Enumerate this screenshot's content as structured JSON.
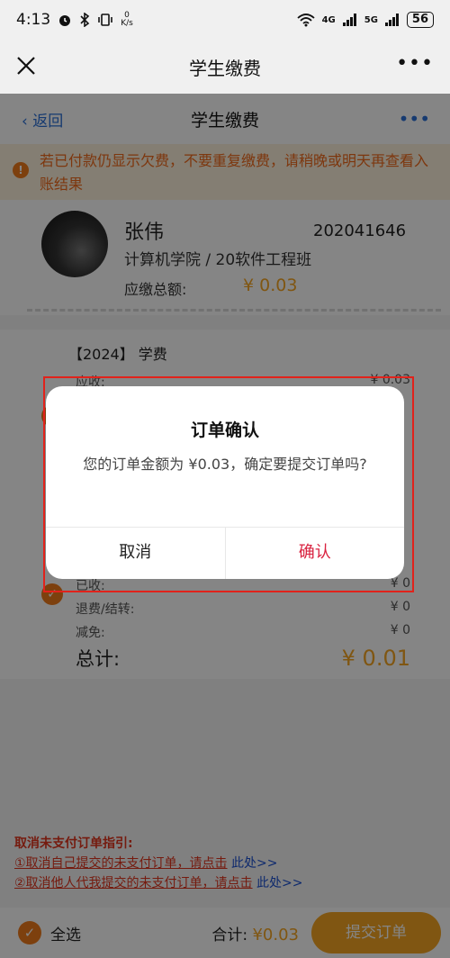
{
  "status_bar": {
    "time": "4:13",
    "net_speed_value": "0",
    "net_speed_unit": "K/s",
    "signal_4g": "4G",
    "signal_5g": "5G",
    "battery": "56"
  },
  "app_bar": {
    "title": "学生缴费",
    "more": "•••"
  },
  "inner_bar": {
    "back_label": "返回",
    "title": "学生缴费",
    "more": "•••"
  },
  "notice": {
    "text": "若已付款仍显示欠费，不要重复缴费，请稍晚或明天再查看入账结果"
  },
  "student": {
    "name": "张伟",
    "id": "202041646",
    "college": "计算机学院 / 20软件工程班",
    "due_label": "应缴总额:",
    "due_value": "¥ 0.03"
  },
  "fee_card": {
    "title": "【2024】 学费",
    "rows": [
      {
        "label": "应收:",
        "value": "¥ 0.03"
      },
      {
        "label": "已收:",
        "value": "¥ 0"
      },
      {
        "label": "退费/结转:",
        "value": "¥ 0"
      },
      {
        "label": "减免:",
        "value": "¥ 0"
      }
    ],
    "total_label": "总计:",
    "total_value": "¥ 0.01"
  },
  "guide": {
    "heading": "取消未支付订单指引:",
    "line1_text": "①取消自己提交的未支付订单，请点击",
    "line1_link": "此处>>",
    "line2_text": "②取消他人代我提交的未支付订单，请点击",
    "line2_link": "此处>>"
  },
  "bottom_bar": {
    "select_all_label": "全选",
    "sum_label": "合计:",
    "sum_value": "¥0.03",
    "submit_label": "提交订单"
  },
  "dialog": {
    "title": "订单确认",
    "message": "您的订单金额为 ¥0.03，确定要提交订单吗?",
    "cancel_label": "取消",
    "confirm_label": "确认"
  },
  "colors": {
    "accent_orange": "#f5a623",
    "confirm_red": "#d9213f",
    "link_blue": "#2b6fd6",
    "highlight_red": "#e1221b"
  }
}
